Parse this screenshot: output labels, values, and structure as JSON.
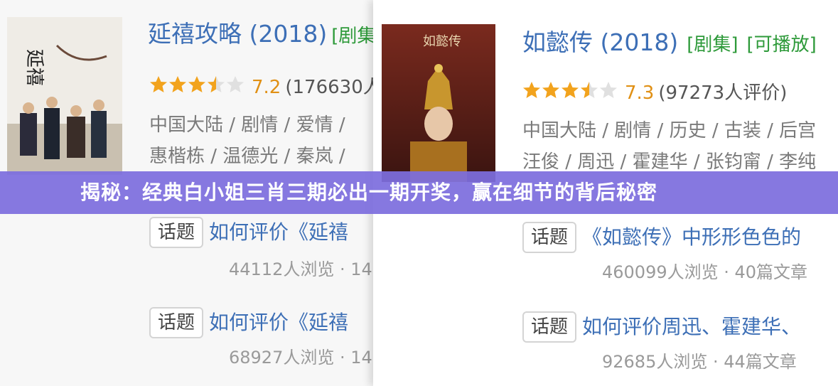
{
  "left_card": {
    "title": "延禧攻略 (2018)",
    "tag": "[剧集",
    "rating_score": 3.5,
    "score": "7.2",
    "rating_count": "(176630人",
    "meta_line1": "中国大陆 / 剧情 / 爱情 / ",
    "meta_line2": "惠楷栋 / 温德光 / 秦岚 / ",
    "topics": [
      {
        "badge": "话题",
        "link": "如何评价《延禧",
        "views": "44112人浏览 · 14"
      },
      {
        "badge": "话题",
        "link": "如何评价《延禧",
        "views": "68927人浏览 · 14"
      }
    ]
  },
  "right_card": {
    "title": "如懿传 (2018)",
    "tag1": "[剧集]",
    "tag2": "[可播放]",
    "rating_score": 3.5,
    "score": "7.3",
    "rating_count": "(97273人评价)",
    "meta_line1": "中国大陆 / 剧情 / 历史 / 古装 / 后宫",
    "meta_line2": "汪俊 / 周迅 / 霍建华 / 张钧甯 / 李纯",
    "topics": [
      {
        "badge": "话题",
        "link": "《如懿传》中形形色色的",
        "views": "460099人浏览 · 40篇文章"
      },
      {
        "badge": "话题",
        "link": "如何评价周迅、霍建华、",
        "views": "92685人浏览 · 44篇文章"
      }
    ]
  },
  "banner": {
    "text": "揭秘：经典白小姐三肖三期必出一期开奖，赢在细节的背后秘密"
  },
  "colors": {
    "title_blue": "#3d6fb6",
    "tag_green": "#2e9a3a",
    "score_orange": "#e09015",
    "star_gold": "#f2a31d",
    "banner_purple": "#7d6ede"
  }
}
